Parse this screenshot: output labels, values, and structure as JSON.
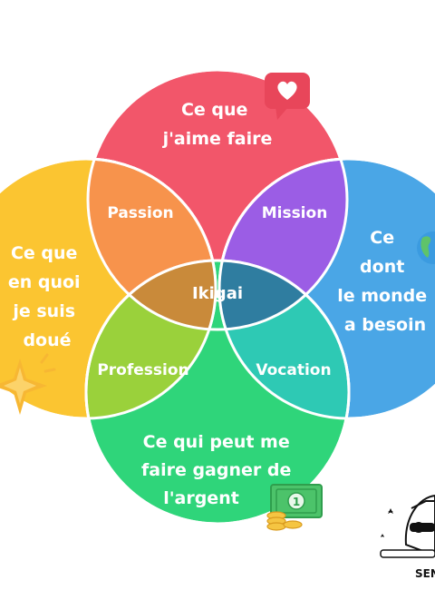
{
  "circles": {
    "top": {
      "lines": [
        "Ce que",
        "j'aime faire"
      ],
      "color": "#f2566a"
    },
    "left": {
      "lines": [
        "Ce que",
        "en quoi",
        "je suis",
        "doué"
      ],
      "color": "#fbc531"
    },
    "right": {
      "lines": [
        "Ce",
        "dont",
        "le monde",
        "a besoin"
      ],
      "color": "#4aa6e6"
    },
    "bottom": {
      "lines": [
        "Ce qui peut me",
        "faire gagner de",
        "l'argent"
      ],
      "color": "#2fd57a"
    }
  },
  "overlaps": {
    "passion": {
      "label": "Passion",
      "color": "#f7934c"
    },
    "mission": {
      "label": "Mission",
      "color": "#9b5de5"
    },
    "profession": {
      "label": "Profession",
      "color": "#9ad13b"
    },
    "vocation": {
      "label": "Vocation",
      "color": "#2ec9b4"
    }
  },
  "center": {
    "label": "Ikigai",
    "color": "#556687"
  },
  "mascot": {
    "text": "SEN"
  },
  "icons": [
    "heart-message-icon",
    "sparkle-star-icon",
    "globe-icon",
    "money-icon",
    "mascot-sunglasses-icon"
  ]
}
